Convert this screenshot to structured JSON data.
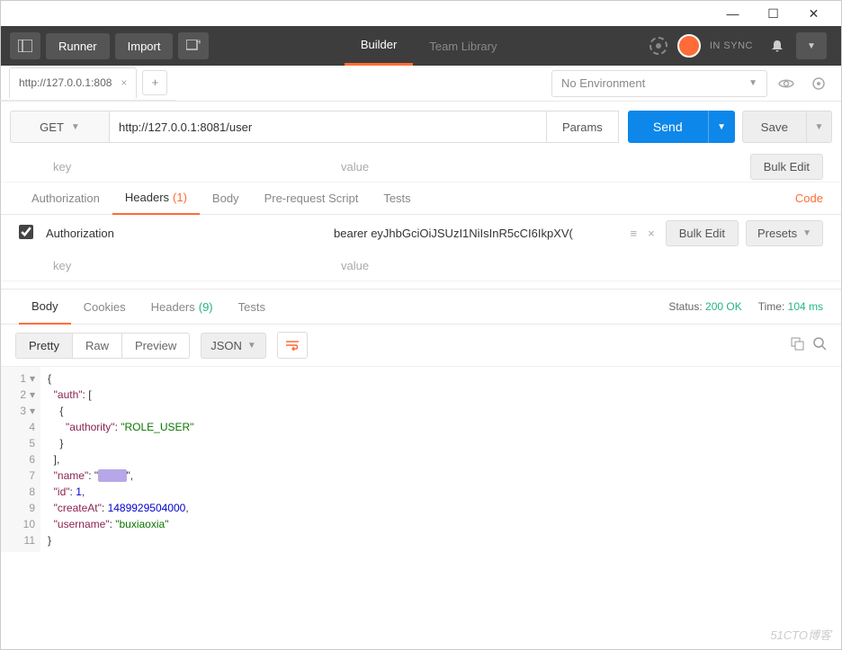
{
  "titlebar": {
    "min": "—",
    "max": "☐",
    "close": "✕"
  },
  "topbar": {
    "runner": "Runner",
    "import": "Import",
    "builder": "Builder",
    "team_library": "Team Library",
    "sync_status": "IN SYNC"
  },
  "env": {
    "selector": "No Environment"
  },
  "request_tab": {
    "title": "http://127.0.0.1:808",
    "add": "+"
  },
  "request": {
    "method": "GET",
    "url": "http://127.0.0.1:8081/user",
    "params": "Params",
    "send": "Send",
    "save": "Save"
  },
  "kv_placeholder": {
    "key": "key",
    "value": "value"
  },
  "bulk_edit": "Bulk Edit",
  "req_tabs": {
    "auth": "Authorization",
    "headers": "Headers",
    "headers_count": "(1)",
    "body": "Body",
    "prereq": "Pre-request Script",
    "tests": "Tests",
    "code": "Code"
  },
  "header_row": {
    "key": "Authorization",
    "value": "bearer eyJhbGciOiJSUzI1NiIsInR5cCI6IkpXV(",
    "presets": "Presets"
  },
  "resp_tabs": {
    "body": "Body",
    "cookies": "Cookies",
    "headers": "Headers",
    "headers_count": "(9)",
    "tests": "Tests",
    "status_label": "Status:",
    "status_value": "200 OK",
    "time_label": "Time:",
    "time_value": "104 ms"
  },
  "fmt": {
    "pretty": "Pretty",
    "raw": "Raw",
    "preview": "Preview",
    "json": "JSON"
  },
  "response_json": {
    "l1": "{",
    "l2_k": "\"auth\"",
    "l2_r": ": [",
    "l3": "    {",
    "l4_k": "\"authority\"",
    "l4_v": "\"ROLE_USER\"",
    "l5": "    }",
    "l6": "  ],",
    "l7_k": "\"name\"",
    "l7_r": ",",
    "l8_k": "\"id\"",
    "l8_v": "1",
    "l9_k": "\"createAt\"",
    "l9_v": "1489929504000",
    "l10_k": "\"username\"",
    "l10_v": "\"buxiaoxia\"",
    "l11": "}"
  },
  "watermark": "51CTO博客"
}
